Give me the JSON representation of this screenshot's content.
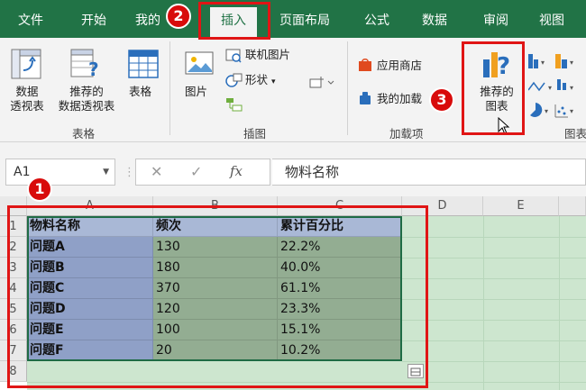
{
  "ribbon_tabs": {
    "file": "文件",
    "home": "开始",
    "mine": "我的",
    "insert": "插入",
    "page_layout": "页面布局",
    "formulas": "公式",
    "data": "数据",
    "review": "审阅",
    "view": "视图"
  },
  "tables_group": {
    "pivot_line1": "数据",
    "pivot_line2": "透视表",
    "recommended_pivot_line1": "推荐的",
    "recommended_pivot_line2": "数据透视表",
    "table": "表格",
    "label": "表格"
  },
  "illustrations_group": {
    "pictures": "图片",
    "online_pictures": "联机图片",
    "shapes": "形状",
    "label": "插图"
  },
  "addins_group": {
    "store": "应用商店",
    "my_addins": "我的加载",
    "label": "加载项"
  },
  "charts_group": {
    "recommended_line1": "推荐的",
    "recommended_line2": "图表",
    "label": "图表"
  },
  "formula_bar": {
    "name_box": "A1",
    "fx": "fx",
    "content": "物料名称"
  },
  "columns": [
    "A",
    "B",
    "C",
    "D",
    "E"
  ],
  "rows": [
    "1",
    "2",
    "3",
    "4",
    "5",
    "6",
    "7",
    "8"
  ],
  "table": {
    "headers": [
      "物料名称",
      "频次",
      "累计百分比"
    ],
    "rows": [
      [
        "问题A",
        "130",
        "22.2%"
      ],
      [
        "问题B",
        "180",
        "40.0%"
      ],
      [
        "问题C",
        "370",
        "61.1%"
      ],
      [
        "问题D",
        "120",
        "23.3%"
      ],
      [
        "问题E",
        "100",
        "15.1%"
      ],
      [
        "问题F",
        "20",
        "10.2%"
      ]
    ]
  },
  "annotations": {
    "step1": "1",
    "step2": "2",
    "step3": "3",
    "color": "#d80b0b"
  },
  "colors": {
    "ribbon_green": "#217346",
    "selection_green": "#cde6cf",
    "header_blue": "#a9b8d6",
    "data_blue": "#8fa0c7",
    "data_green": "#93ad92"
  }
}
